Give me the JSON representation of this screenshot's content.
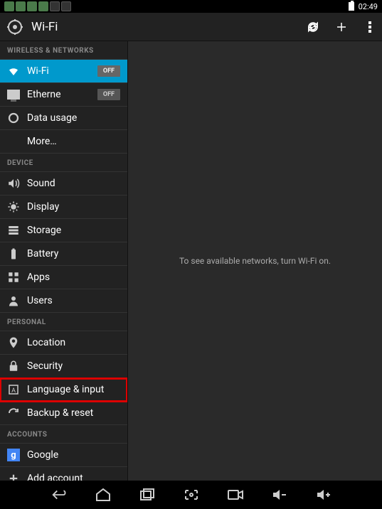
{
  "status": {
    "time": "02:49"
  },
  "actionbar": {
    "title": "Wi-Fi"
  },
  "sections": {
    "wireless": {
      "header": "WIRELESS & NETWORKS",
      "wifi": {
        "label": "Wi-Fi",
        "toggle": "OFF"
      },
      "ethernet": {
        "label": "Etherne",
        "toggle": "OFF"
      },
      "data_usage": {
        "label": "Data usage"
      },
      "more": {
        "label": "More…"
      }
    },
    "device": {
      "header": "DEVICE",
      "sound": {
        "label": "Sound"
      },
      "display": {
        "label": "Display"
      },
      "storage": {
        "label": "Storage"
      },
      "battery": {
        "label": "Battery"
      },
      "apps": {
        "label": "Apps"
      },
      "users": {
        "label": "Users"
      }
    },
    "personal": {
      "header": "PERSONAL",
      "location": {
        "label": "Location"
      },
      "security": {
        "label": "Security"
      },
      "language": {
        "label": "Language & input"
      },
      "backup": {
        "label": "Backup & reset"
      }
    },
    "accounts": {
      "header": "ACCOUNTS",
      "google": {
        "label": "Google"
      },
      "add": {
        "label": "Add account"
      }
    }
  },
  "detail": {
    "message": "To see available networks, turn Wi-Fi on."
  }
}
